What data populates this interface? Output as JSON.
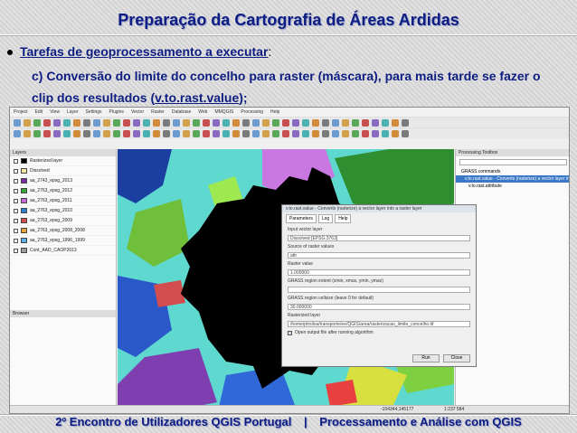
{
  "slide": {
    "title": "Preparação da Cartografia de Áreas Ardidas",
    "bullet_link": "Tarefas de geoprocessamento a executar",
    "bullet_suffix": ":",
    "sub_prefix": "c) Conversão do limite do concelho para raster (máscara), para mais tarde se fazer o clip dos resultados (",
    "sub_link": "v.to.rast.value",
    "sub_suffix": ");",
    "footer_left": "2º Encontro de Utilizadores QGIS Portugal",
    "footer_sep": "|",
    "footer_right": "Processamento e Análise com QGIS"
  },
  "qgis": {
    "menus": [
      "Project",
      "Edit",
      "View",
      "Layer",
      "Settings",
      "Plugins",
      "Vector",
      "Raster",
      "Database",
      "Web",
      "MMQGIS",
      "Processing",
      "Help"
    ],
    "layers_panel_title": "Layers",
    "layers": [
      {
        "name": "Rasterized layer",
        "color": "#000000"
      },
      {
        "name": "Dissolved",
        "color": "#f5e6a0"
      },
      {
        "name": "aa_2743_epsg_2013",
        "color": "#7b2f9e"
      },
      {
        "name": "aa_2763_epsg_2012",
        "color": "#3aa63a"
      },
      {
        "name": "aa_2763_epsg_2011",
        "color": "#c86ad8"
      },
      {
        "name": "aa_2763_epsg_2010",
        "color": "#2f7fd2"
      },
      {
        "name": "aa_2763_epsg_2009",
        "color": "#d24d4d"
      },
      {
        "name": "aa_2763_epsg_2008_2008",
        "color": "#e8a23c"
      },
      {
        "name": "aa_2763_epsg_1996_1999",
        "color": "#5ab3e8"
      },
      {
        "name": "Cont_AAD_CAOP2013",
        "color": "#9e9e9e"
      }
    ],
    "browser_panel_title": "Browser",
    "toolbox_title": "Processing Toolbox",
    "toolbox_items": [
      "GRASS commands",
      "v.to.rast.value - Converts (rasterize) a vector layer into a raster layer",
      "v.to.rast.attribute"
    ],
    "dialog": {
      "title": "v.to.rast.value - Converts (rasterize) a vector layer into a raster layer",
      "tabs": [
        "Parameters",
        "Log",
        "Help"
      ],
      "fields": [
        {
          "label": "Input vector layer",
          "value": "Dissolved [EPSG:3763]"
        },
        {
          "label": "Source of raster values",
          "value": "attr"
        },
        {
          "label": "Raster value",
          "value": "1.000000"
        },
        {
          "label": "GRASS region extent (xmin, xmax, ymin, ymax)",
          "value": ""
        },
        {
          "label": "GRASS region cellsize (leave 0 for default)",
          "value": "30.000000"
        },
        {
          "label": "Rasterized layer",
          "value": "/home/ptrsilva/transporte/ee/QGIS/area/rasterizacao_limite_concelho.tif"
        }
      ],
      "checkbox": "Open output file after running algorithm",
      "run_label": "Run",
      "close_label": "Close"
    },
    "status_coordinate": "-104344,145177",
    "status_scale": "1:237 584"
  }
}
